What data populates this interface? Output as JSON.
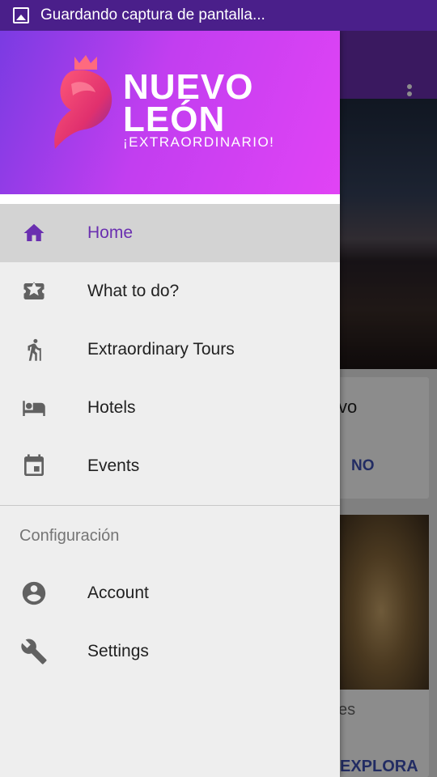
{
  "status_bar": {
    "notification_icon": "image-icon",
    "text": "Guardando captura de pantalla..."
  },
  "header": {
    "logo_title_line1": "NUEVO",
    "logo_title_line2": "LEÓN",
    "logo_tagline": "¡EXTRAORDINARIO!",
    "gradient_start": "#7a3be2",
    "gradient_end": "#e143f5"
  },
  "menu": {
    "items": [
      {
        "label": "Home",
        "icon": "home-icon",
        "active": true
      },
      {
        "label": "What to do?",
        "icon": "ticket-star-icon",
        "active": false
      },
      {
        "label": "Extraordinary Tours",
        "icon": "hiker-icon",
        "active": false
      },
      {
        "label": "Hotels",
        "icon": "bed-icon",
        "active": false
      },
      {
        "label": "Events",
        "icon": "calendar-icon",
        "active": false
      }
    ],
    "active_color": "#6a2fb0"
  },
  "config_section": {
    "title": "Configuración",
    "items": [
      {
        "label": "Account",
        "icon": "account-circle-icon"
      },
      {
        "label": "Settings",
        "icon": "wrench-icon"
      }
    ]
  },
  "background_app": {
    "card1_text": "vo",
    "card1_link": "NO",
    "card2_text": "es",
    "card2_link": "EXPLORA",
    "overflow_icon": "more-vert-icon"
  }
}
